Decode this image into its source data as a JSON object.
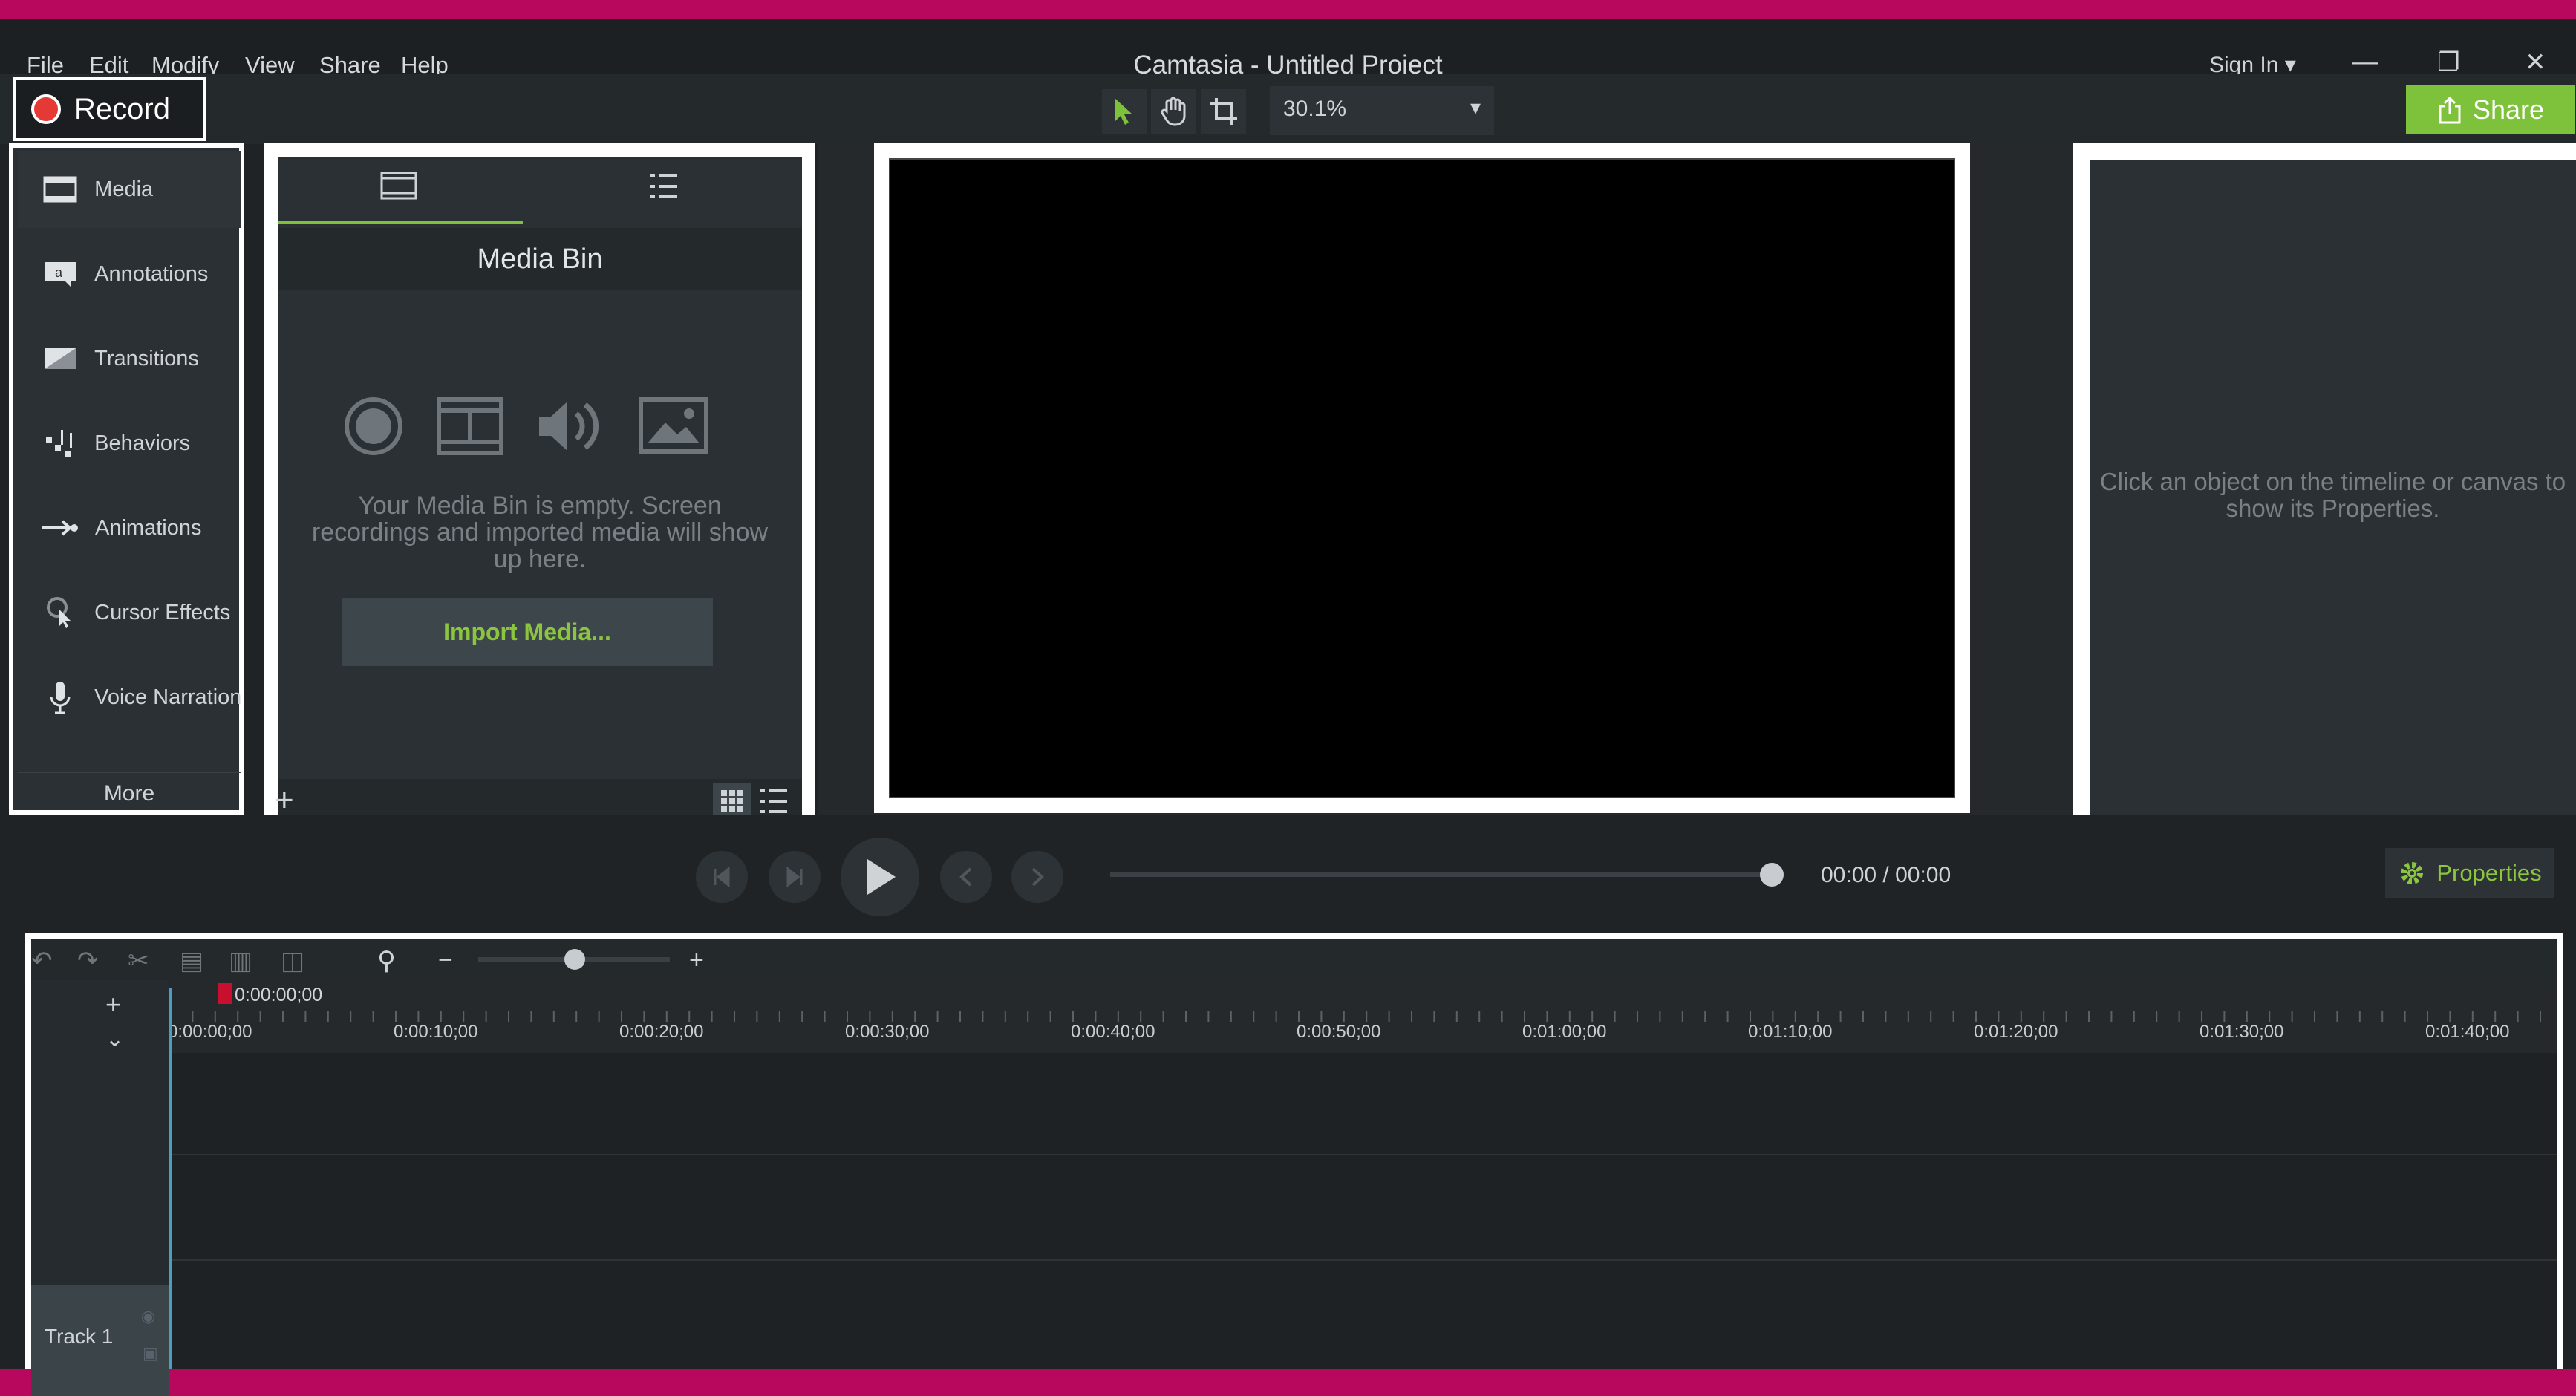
{
  "window": {
    "title": "Camtasia - Untitled Project",
    "menu": [
      "File",
      "Edit",
      "Modify",
      "View",
      "Share",
      "Help"
    ],
    "sign_in": "Sign In ▾",
    "minimize": "—",
    "restore": "❐",
    "close": "✕"
  },
  "toolbar": {
    "record_label": "Record",
    "zoom_value": "30.1%",
    "share_label": "Share"
  },
  "tools": {
    "items": [
      "Media",
      "Annotations",
      "Transitions",
      "Behaviors",
      "Animations",
      "Cursor Effects",
      "Voice Narration"
    ],
    "more_label": "More"
  },
  "media_bin": {
    "header": "Media Bin",
    "empty_text": "Your Media Bin is empty. Screen recordings and imported media will show up here.",
    "import_label": "Import Media...",
    "add_label": "+"
  },
  "properties": {
    "empty_text": "Click an object on the timeline or canvas to show its Properties.",
    "button_label": "Properties"
  },
  "playback": {
    "time": "00:00  /  00:00",
    "progress": 1.0
  },
  "timeline": {
    "playhead_time": "0:00:00;00",
    "ticks": [
      "0:00:00;00",
      "0:00:10;00",
      "0:00:20;00",
      "0:00:30;00",
      "0:00:40;00",
      "0:00:50;00",
      "0:01:00;00",
      "0:01:10;00",
      "0:01:20;00",
      "0:01:30;00",
      "0:01:40;00"
    ],
    "track_label": "Track 1"
  },
  "colors": {
    "accent": "#7dc23a",
    "record": "#e53935",
    "annotation_border": "#ffffff",
    "background_frame": "#b8085e"
  }
}
